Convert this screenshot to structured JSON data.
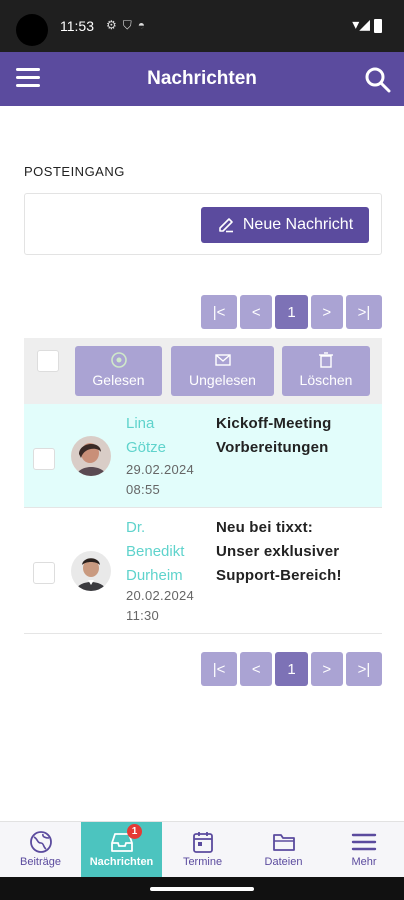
{
  "status_bar": {
    "time": "11:53",
    "icons_left": [
      "settings-icon",
      "shield-icon",
      "app-icon"
    ],
    "icons_right": [
      "wifi-icon",
      "signal-icon",
      "battery-icon"
    ]
  },
  "app_bar": {
    "title": "Nachrichten",
    "menu_icon": "hamburger-menu-icon",
    "search_icon": "search-icon"
  },
  "inbox": {
    "section_label": "POSTEINGANG",
    "new_message_label": "Neue Nachricht",
    "new_message_icon": "pen-icon"
  },
  "pagination": {
    "first": "|<",
    "prev": "<",
    "current": "1",
    "next": ">",
    "last": ">|"
  },
  "actions": {
    "read_label": "Gelesen",
    "unread_label": "Ungelesen",
    "delete_label": "Löschen"
  },
  "messages": [
    {
      "sender_line1": "Lina",
      "sender_line2": "Götze",
      "date": "29.02.2024",
      "time": "08:55",
      "subject_line1": "Kickoff-Meeting",
      "subject_line2": "Vorbereitungen",
      "unread": true
    },
    {
      "sender_line1": "Dr.",
      "sender_line2": "Benedikt",
      "sender_line3": "Durheim",
      "date": "20.02.2024",
      "time": "11:30",
      "subject_line1": "Neu bei tixxt:",
      "subject_line2": "Unser exklusiver",
      "subject_line3": "Support-Bereich!",
      "unread": false
    }
  ],
  "bottom_nav": {
    "items": [
      {
        "label": "Beiträge",
        "icon": "globe-icon"
      },
      {
        "label": "Nachrichten",
        "icon": "inbox-icon",
        "badge": "1",
        "active": true
      },
      {
        "label": "Termine",
        "icon": "calendar-icon"
      },
      {
        "label": "Dateien",
        "icon": "folder-icon"
      },
      {
        "label": "Mehr",
        "icon": "menu-icon"
      }
    ]
  },
  "colors": {
    "primary": "#5b4b9e",
    "primary_light": "#aaa3d3",
    "teal": "#4cc4bf",
    "unread_row": "#e2fdfb",
    "badge": "#e53935"
  }
}
